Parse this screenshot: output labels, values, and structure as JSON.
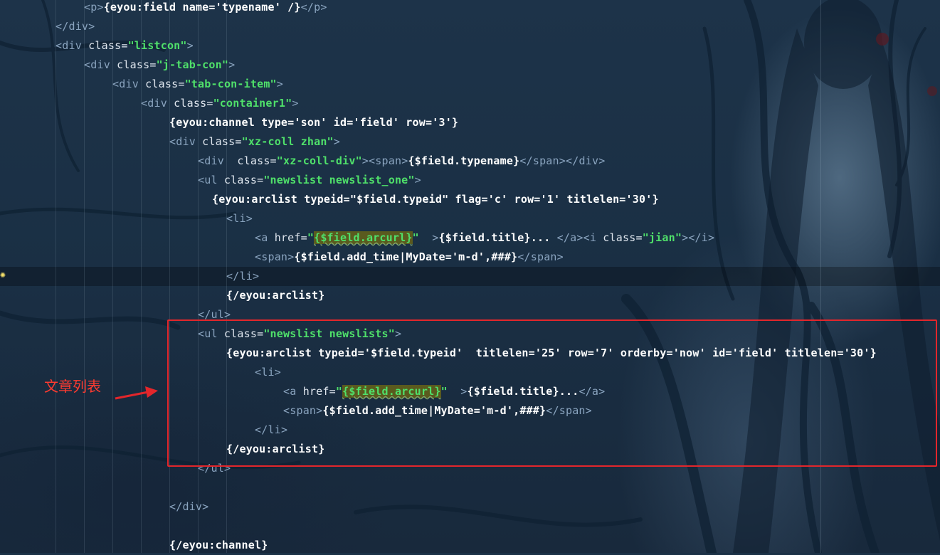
{
  "editor": {
    "lines": [
      {
        "indent": 3,
        "segs": [
          [
            "tag",
            "<"
          ],
          [
            "tag",
            "p"
          ],
          [
            "tag",
            ">"
          ],
          [
            "kw",
            "{eyou:field name='typename' /}"
          ],
          [
            "tag",
            "</"
          ],
          [
            "tag",
            "p"
          ],
          [
            "tag",
            ">"
          ]
        ]
      },
      {
        "indent": 2,
        "segs": [
          [
            "tag",
            "</"
          ],
          [
            "tag",
            "div"
          ],
          [
            "tag",
            ">"
          ]
        ]
      },
      {
        "indent": 2,
        "segs": [
          [
            "tag",
            "<"
          ],
          [
            "tag",
            "div"
          ],
          [
            "attr",
            " class="
          ],
          [
            "str",
            "\"listcon\""
          ],
          [
            "tag",
            ">"
          ]
        ]
      },
      {
        "indent": 3,
        "segs": [
          [
            "tag",
            "<"
          ],
          [
            "tag",
            "div"
          ],
          [
            "attr",
            " class="
          ],
          [
            "str",
            "\"j-tab-con\""
          ],
          [
            "tag",
            ">"
          ]
        ]
      },
      {
        "indent": 4,
        "segs": [
          [
            "tag",
            "<"
          ],
          [
            "tag",
            "div"
          ],
          [
            "attr",
            " class="
          ],
          [
            "str",
            "\"tab-con-item\""
          ],
          [
            "tag",
            ">"
          ]
        ]
      },
      {
        "indent": 5,
        "segs": [
          [
            "tag",
            "<"
          ],
          [
            "tag",
            "div"
          ],
          [
            "attr",
            " class="
          ],
          [
            "str",
            "\"container1\""
          ],
          [
            "tag",
            ">"
          ]
        ]
      },
      {
        "indent": 6,
        "segs": [
          [
            "kw",
            "{eyou:channel type='son' id='field' row='3'}"
          ]
        ]
      },
      {
        "indent": 6,
        "segs": [
          [
            "tag",
            "<"
          ],
          [
            "tag",
            "div"
          ],
          [
            "attr",
            " class="
          ],
          [
            "str",
            "\"xz-coll zhan\""
          ],
          [
            "tag",
            ">"
          ]
        ]
      },
      {
        "indent": 7,
        "segs": [
          [
            "tag",
            "<"
          ],
          [
            "tag",
            "div"
          ],
          [
            "attr",
            "  class="
          ],
          [
            "str",
            "\"xz-coll-div\""
          ],
          [
            "tag",
            ">"
          ],
          [
            "tag",
            "<"
          ],
          [
            "tag",
            "span"
          ],
          [
            "tag",
            ">"
          ],
          [
            "kw",
            "{$field.typename}"
          ],
          [
            "tag",
            "</"
          ],
          [
            "tag",
            "span"
          ],
          [
            "tag",
            ">"
          ],
          [
            "tag",
            "</"
          ],
          [
            "tag",
            "div"
          ],
          [
            "tag",
            ">"
          ]
        ]
      },
      {
        "indent": 7,
        "segs": [
          [
            "tag",
            "<"
          ],
          [
            "tag",
            "ul"
          ],
          [
            "attr",
            " class="
          ],
          [
            "str",
            "\"newslist newslist_one\""
          ],
          [
            "tag",
            ">"
          ]
        ]
      },
      {
        "indent": 7.5,
        "segs": [
          [
            "kw",
            "{eyou:arclist typeid=\"$field.typeid\" flag='c' row='1' titlelen='30'}"
          ]
        ]
      },
      {
        "indent": 8,
        "segs": [
          [
            "tag",
            "<"
          ],
          [
            "tag",
            "li"
          ],
          [
            "tag",
            ">"
          ]
        ]
      },
      {
        "indent": 9,
        "segs": [
          [
            "tag",
            "<"
          ],
          [
            "tag",
            "a"
          ],
          [
            "attr",
            " href="
          ],
          [
            "str",
            "\""
          ],
          [
            "strhl",
            "{$field.arcurl}"
          ],
          [
            "str",
            "\""
          ],
          [
            "attr",
            "  "
          ],
          [
            "tag",
            ">"
          ],
          [
            "kw",
            "{$field.title}... "
          ],
          [
            "tag",
            "</"
          ],
          [
            "tag",
            "a"
          ],
          [
            "tag",
            ">"
          ],
          [
            "tag",
            "<"
          ],
          [
            "tag",
            "i"
          ],
          [
            "attr",
            " class="
          ],
          [
            "str",
            "\"jian\""
          ],
          [
            "tag",
            ">"
          ],
          [
            "tag",
            "</"
          ],
          [
            "tag",
            "i"
          ],
          [
            "tag",
            ">"
          ]
        ]
      },
      {
        "indent": 9,
        "segs": [
          [
            "tag",
            "<"
          ],
          [
            "tag",
            "span"
          ],
          [
            "tag",
            ">"
          ],
          [
            "kw",
            "{$field.add_time|MyDate='m-d',###}"
          ],
          [
            "tag",
            "</"
          ],
          [
            "tag",
            "span"
          ],
          [
            "tag",
            ">"
          ]
        ]
      },
      {
        "indent": 8,
        "segs": [
          [
            "tag",
            "</"
          ],
          [
            "tag",
            "li"
          ],
          [
            "tag",
            ">"
          ]
        ]
      },
      {
        "indent": 8,
        "segs": [
          [
            "kw",
            "{/eyou:arclist}"
          ]
        ]
      },
      {
        "indent": 7,
        "segs": [
          [
            "tag",
            "</"
          ],
          [
            "tag",
            "ul"
          ],
          [
            "tag",
            ">"
          ]
        ]
      },
      {
        "indent": 7,
        "segs": [
          [
            "tag",
            "<"
          ],
          [
            "tag",
            "ul"
          ],
          [
            "attr",
            " class="
          ],
          [
            "str",
            "\"newslist newslists\""
          ],
          [
            "tag",
            ">"
          ]
        ]
      },
      {
        "indent": 8,
        "segs": [
          [
            "kw",
            "{eyou:arclist typeid='$field.typeid'  titlelen='25' row='7' orderby='now' id='field' titlelen='30'}"
          ]
        ]
      },
      {
        "indent": 9,
        "segs": [
          [
            "tag",
            "<"
          ],
          [
            "tag",
            "li"
          ],
          [
            "tag",
            ">"
          ]
        ]
      },
      {
        "indent": 10,
        "segs": [
          [
            "tag",
            "<"
          ],
          [
            "tag",
            "a"
          ],
          [
            "attr",
            " href="
          ],
          [
            "str",
            "\""
          ],
          [
            "strhl",
            "{$field.arcurl}"
          ],
          [
            "str",
            "\""
          ],
          [
            "attr",
            "  "
          ],
          [
            "tag",
            ">"
          ],
          [
            "kw",
            "{$field.title}..."
          ],
          [
            "tag",
            "</"
          ],
          [
            "tag",
            "a"
          ],
          [
            "tag",
            ">"
          ]
        ]
      },
      {
        "indent": 10,
        "segs": [
          [
            "tag",
            "<"
          ],
          [
            "tag",
            "span"
          ],
          [
            "tag",
            ">"
          ],
          [
            "kw",
            "{$field.add_time|MyDate='m-d',###}"
          ],
          [
            "tag",
            "</"
          ],
          [
            "tag",
            "span"
          ],
          [
            "tag",
            ">"
          ]
        ]
      },
      {
        "indent": 9,
        "segs": [
          [
            "tag",
            "</"
          ],
          [
            "tag",
            "li"
          ],
          [
            "tag",
            ">"
          ]
        ]
      },
      {
        "indent": 8,
        "segs": [
          [
            "kw",
            "{/eyou:arclist}"
          ]
        ]
      },
      {
        "indent": 7,
        "segs": [
          [
            "tag",
            "</"
          ],
          [
            "tag",
            "ul"
          ],
          [
            "tag",
            ">"
          ]
        ]
      },
      {
        "indent": 0,
        "segs": []
      },
      {
        "indent": 6,
        "segs": [
          [
            "tag",
            "</"
          ],
          [
            "tag",
            "div"
          ],
          [
            "tag",
            ">"
          ]
        ]
      },
      {
        "indent": 0,
        "segs": []
      },
      {
        "indent": 6,
        "segs": [
          [
            "kw",
            "{/eyou:channel}"
          ]
        ]
      }
    ]
  },
  "annotation": {
    "label": "文章列表",
    "border_color": "#e3262b",
    "label_color": "#ff3b30"
  },
  "colors": {
    "background": "#1b3146",
    "tag": "#8aa4bf",
    "string": "#4fe06a",
    "keyword": "#ffffff",
    "highlight": "#5a5a1e"
  },
  "icons": {
    "gutter_hint": "lightbulb-icon"
  }
}
